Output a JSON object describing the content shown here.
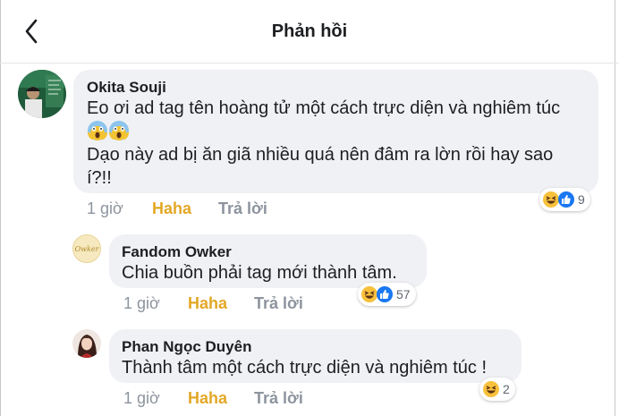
{
  "header": {
    "title": "Phản hồi"
  },
  "comments": [
    {
      "author": "Okita Souji",
      "lines": [
        "Eo ơi ad tag tên hoàng tử một cách trực diện và nghiêm túc",
        "😱😱",
        "Dạo này ad bị ăn giã nhiều quá nên đâm ra lờn rồi hay sao",
        "í?!!"
      ],
      "time": "1 giờ",
      "reacted": "Haha",
      "reply": "Trả lời",
      "reaction_count": "9"
    },
    {
      "author": "Fandom Owker",
      "avatar_text": "Owker",
      "lines": [
        "Chia buồn phải tag mới thành tâm."
      ],
      "time": "1 giờ",
      "reacted": "Haha",
      "reply": "Trả lời",
      "reaction_count": "57"
    },
    {
      "author": "Phan Ngọc Duyên",
      "lines": [
        "Thành tâm một cách trực diện và nghiêm túc !"
      ],
      "time": "1 giờ",
      "reacted": "Haha",
      "reply": "Trả lời",
      "reaction_count": "2"
    }
  ],
  "colors": {
    "bubble": "#eff1f4",
    "haha": "#e2a826",
    "like": "#1877f2",
    "meta": "#8d949e"
  },
  "icons": [
    "back-arrow-icon",
    "screaming-face-emoji-icon",
    "haha-reaction-icon",
    "like-reaction-icon"
  ]
}
